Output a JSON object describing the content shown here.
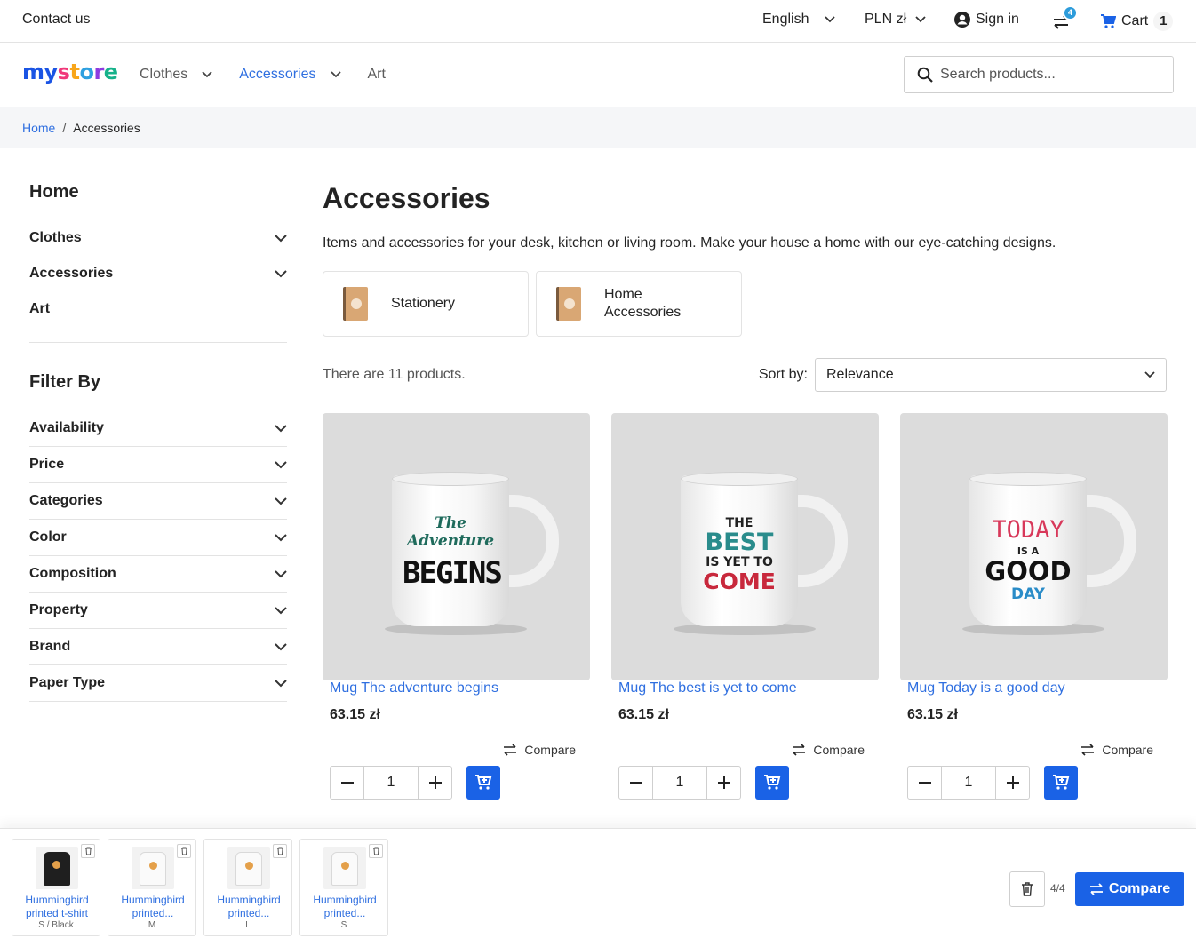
{
  "topbar": {
    "contact": "Contact us",
    "language": "English",
    "currency": "PLN zł",
    "sign_in": "Sign in",
    "compare_badge": "4",
    "cart_label": "Cart",
    "cart_count": "1"
  },
  "header": {
    "logo_my": "my",
    "logo_store": [
      "s",
      "t",
      "o",
      "r",
      "e"
    ],
    "nav": [
      {
        "label": "Clothes",
        "active": false
      },
      {
        "label": "Accessories",
        "active": true
      },
      {
        "label": "Art",
        "active": false
      }
    ],
    "search_placeholder": "Search products..."
  },
  "breadcrumb": {
    "home": "Home",
    "separator": "/",
    "current": "Accessories"
  },
  "sidebar": {
    "home": "Home",
    "categories": [
      "Clothes",
      "Accessories",
      "Art"
    ],
    "filter_title": "Filter By",
    "filters": [
      "Availability",
      "Price",
      "Categories",
      "Color",
      "Composition",
      "Property",
      "Brand",
      "Paper Type"
    ]
  },
  "main": {
    "title": "Accessories",
    "description": "Items and accessories for your desk, kitchen or living room. Make your house a home with our eye-catching designs.",
    "subcategories": [
      {
        "label": "Stationery"
      },
      {
        "label_line1": "Home",
        "label_line2": "Accessories"
      }
    ],
    "product_count": "There are 11 products.",
    "sort_label": "Sort by:",
    "sort_value": "Relevance",
    "compare_label": "Compare",
    "quantity": "1",
    "products": [
      {
        "name": "Mug The adventure begins",
        "price": "63.15 zł",
        "mug_line1": "The Adventure",
        "mug_line2": "BEGINS"
      },
      {
        "name": "Mug The best is yet to come",
        "price": "63.15 zł",
        "mug_line1": "THE",
        "mug_line2": "BEST",
        "mug_line3": "IS YET TO",
        "mug_line4": "COME"
      },
      {
        "name": "Mug Today is a good day",
        "price": "63.15 zł",
        "mug_line1": "TODAY",
        "mug_line2": "IS A",
        "mug_line3": "GOOD",
        "mug_line4": "DAY"
      }
    ]
  },
  "compare_bar": {
    "items": [
      {
        "name": "Hummingbird printed t-shirt",
        "variant": "S / Black",
        "tee": "black"
      },
      {
        "name": "Hummingbird printed...",
        "variant": "M",
        "tee": "white"
      },
      {
        "name": "Hummingbird printed...",
        "variant": "L",
        "tee": "white"
      },
      {
        "name": "Hummingbird printed...",
        "variant": "S",
        "tee": "white"
      }
    ],
    "count": "4/4",
    "button": "Compare"
  },
  "colors": {
    "accent": "#1a62e6",
    "link": "#2f6fe0",
    "badge": "#2d9cdb"
  }
}
